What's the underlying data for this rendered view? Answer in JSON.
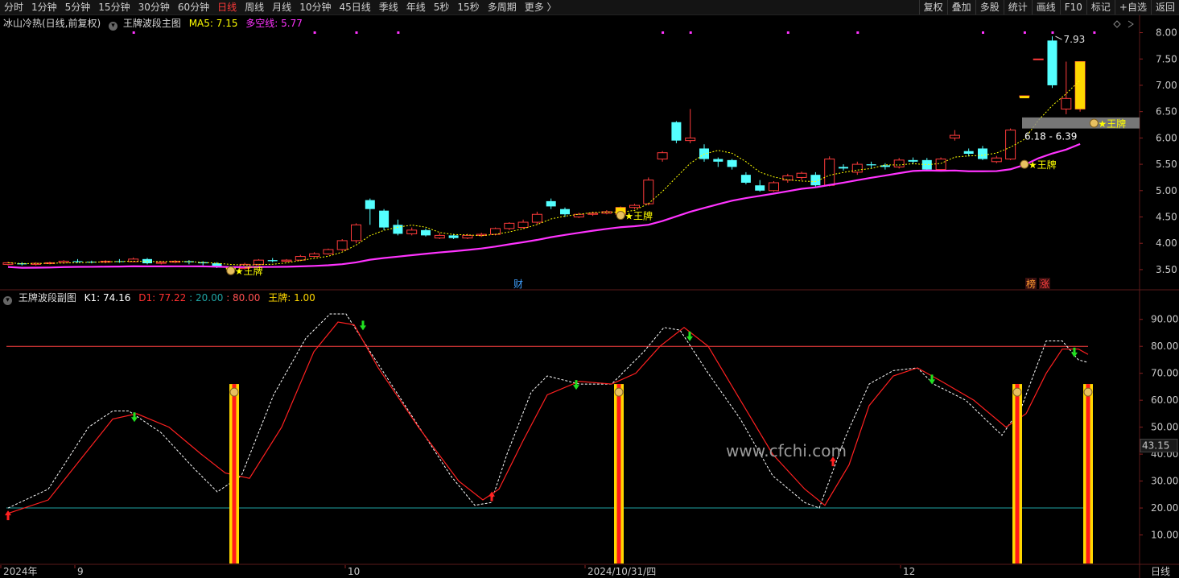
{
  "toolbar": {
    "periods": [
      "分时",
      "1分钟",
      "5分钟",
      "15分钟",
      "30分钟",
      "60分钟",
      "日线",
      "周线",
      "月线",
      "10分钟",
      "45日线",
      "季线",
      "年线",
      "5秒",
      "15秒",
      "多周期",
      "更多 〉"
    ],
    "active_period": "日线",
    "right_tools": [
      "复权",
      "叠加",
      "多股",
      "统计",
      "画线",
      "F10",
      "标记",
      "+自选",
      "返回"
    ]
  },
  "main_header": {
    "stock": "冰山冷热(日线,前复权)",
    "indicator": "王牌波段主图",
    "ma5_label": "MA5: 7.15",
    "dkx_label": "多空线: 5.77"
  },
  "sub_header": {
    "indicator": "王牌波段副图",
    "k1": "K1: 74.16",
    "d1": "D1: 77.22",
    "lv20": ": 20.00",
    "lv80": ": 80.00",
    "wangpai": "王牌: 1.00"
  },
  "annotations": {
    "high_price": "7.93",
    "range_label": "6.18 - 6.39",
    "wangpai_tag": "★王牌",
    "cai_tag": "财",
    "bang_tag": "榜",
    "zhang_tag": "涨",
    "watermark": "www.cfchi.com",
    "sub_current": "43.15"
  },
  "price_axis": [
    "8.00",
    "7.50",
    "7.00",
    "6.50",
    "6.00",
    "5.50",
    "5.00",
    "4.50",
    "4.00",
    "3.50"
  ],
  "osc_axis": [
    "90.00",
    "80.00",
    "70.00",
    "60.00",
    "50.00",
    "40.00",
    "30.00",
    "20.00",
    "10.00"
  ],
  "date_axis": {
    "labels": [
      "2024年",
      "9",
      "10",
      "2024/10/31/四",
      "12",
      "日线"
    ]
  },
  "colors": {
    "up": "#ff3b3b",
    "down": "#54ffff",
    "ma5": "#ffff00",
    "dkx": "#ff33ff",
    "k1": "#ffffff",
    "d1": "#ff2020",
    "level20": "#1fa3a3",
    "level80": "#ff4040",
    "wangpai_bar": "#ffd700"
  },
  "chart_data": {
    "type": "candlestick",
    "price_ylim": [
      3.3,
      8.1
    ],
    "osc_ylim": [
      0,
      95
    ],
    "candles": [
      [
        3.6,
        3.63,
        3.58,
        3.65
      ],
      [
        3.62,
        3.6,
        3.58,
        3.64
      ],
      [
        3.6,
        3.62,
        3.58,
        3.64
      ],
      [
        3.62,
        3.63,
        3.6,
        3.65
      ],
      [
        3.63,
        3.66,
        3.61,
        3.68
      ],
      [
        3.66,
        3.65,
        3.63,
        3.7
      ],
      [
        3.65,
        3.64,
        3.62,
        3.67
      ],
      [
        3.64,
        3.66,
        3.62,
        3.68
      ],
      [
        3.66,
        3.65,
        3.63,
        3.7
      ],
      [
        3.65,
        3.7,
        3.64,
        3.73
      ],
      [
        3.7,
        3.62,
        3.6,
        3.72
      ],
      [
        3.62,
        3.64,
        3.6,
        3.66
      ],
      [
        3.64,
        3.66,
        3.62,
        3.68
      ],
      [
        3.66,
        3.64,
        3.6,
        3.68
      ],
      [
        3.64,
        3.62,
        3.58,
        3.66
      ],
      [
        3.62,
        3.55,
        3.53,
        3.64
      ],
      [
        3.55,
        3.52,
        3.48,
        3.57
      ],
      [
        3.52,
        3.6,
        3.5,
        3.63
      ],
      [
        3.6,
        3.68,
        3.58,
        3.7
      ],
      [
        3.68,
        3.66,
        3.64,
        3.72
      ],
      [
        3.66,
        3.68,
        3.64,
        3.7
      ],
      [
        3.68,
        3.75,
        3.66,
        3.78
      ],
      [
        3.75,
        3.8,
        3.73,
        3.83
      ],
      [
        3.8,
        3.88,
        3.78,
        3.9
      ],
      [
        3.88,
        4.05,
        3.85,
        4.08
      ],
      [
        4.05,
        4.35,
        4.0,
        4.38
      ],
      [
        4.82,
        4.65,
        4.35,
        4.85
      ],
      [
        4.62,
        4.3,
        4.25,
        4.65
      ],
      [
        4.35,
        4.18,
        4.15,
        4.45
      ],
      [
        4.18,
        4.25,
        4.15,
        4.3
      ],
      [
        4.25,
        4.15,
        4.13,
        4.28
      ],
      [
        4.1,
        4.15,
        4.08,
        4.2
      ],
      [
        4.15,
        4.1,
        4.08,
        4.18
      ],
      [
        4.1,
        4.15,
        4.08,
        4.18
      ],
      [
        4.15,
        4.17,
        4.12,
        4.2
      ],
      [
        4.17,
        4.28,
        4.15,
        4.3
      ],
      [
        4.28,
        4.38,
        4.25,
        4.4
      ],
      [
        4.3,
        4.4,
        4.28,
        4.45
      ],
      [
        4.4,
        4.55,
        4.35,
        4.6
      ],
      [
        4.8,
        4.7,
        4.65,
        4.85
      ],
      [
        4.65,
        4.55,
        4.5,
        4.68
      ],
      [
        4.5,
        4.55,
        4.48,
        4.58
      ],
      [
        4.55,
        4.57,
        4.52,
        4.6
      ],
      [
        4.57,
        4.6,
        4.55,
        4.63
      ],
      [
        4.55,
        4.68,
        4.5,
        4.7
      ],
      [
        4.68,
        4.72,
        4.65,
        4.75
      ],
      [
        4.75,
        5.2,
        4.72,
        5.25
      ],
      [
        5.6,
        5.72,
        5.55,
        5.75
      ],
      [
        6.3,
        5.95,
        5.9,
        6.32
      ],
      [
        5.95,
        6.0,
        5.9,
        6.55
      ],
      [
        5.8,
        5.6,
        5.55,
        5.88
      ],
      [
        5.6,
        5.55,
        5.45,
        5.63
      ],
      [
        5.58,
        5.45,
        5.4,
        5.6
      ],
      [
        5.3,
        5.15,
        5.12,
        5.35
      ],
      [
        5.1,
        5.0,
        4.98,
        5.2
      ],
      [
        5.0,
        5.15,
        4.98,
        5.18
      ],
      [
        5.2,
        5.28,
        5.15,
        5.32
      ],
      [
        5.25,
        5.33,
        5.2,
        5.36
      ],
      [
        5.3,
        5.1,
        5.05,
        5.35
      ],
      [
        5.1,
        5.6,
        5.08,
        5.65
      ],
      [
        5.45,
        5.42,
        5.38,
        5.5
      ],
      [
        5.35,
        5.5,
        5.3,
        5.55
      ],
      [
        5.5,
        5.48,
        5.42,
        5.55
      ],
      [
        5.48,
        5.45,
        5.4,
        5.52
      ],
      [
        5.45,
        5.58,
        5.42,
        5.62
      ],
      [
        5.58,
        5.55,
        5.5,
        5.63
      ],
      [
        5.58,
        5.4,
        5.38,
        5.62
      ],
      [
        5.4,
        5.6,
        5.38,
        5.63
      ],
      [
        6.0,
        6.05,
        5.95,
        6.15
      ],
      [
        5.75,
        5.7,
        5.65,
        5.8
      ],
      [
        5.8,
        5.6,
        5.58,
        5.85
      ],
      [
        5.55,
        5.62,
        5.52,
        5.66
      ],
      [
        5.6,
        6.15,
        5.58,
        6.18
      ],
      [
        6.8,
        6.8,
        6.8,
        6.8
      ],
      [
        7.5,
        7.5,
        7.5,
        7.5
      ],
      [
        7.85,
        7.0,
        6.95,
        7.93
      ],
      [
        6.55,
        6.75,
        6.45,
        7.45
      ],
      [
        6.55,
        7.45,
        6.5,
        7.45
      ]
    ],
    "ma5_series": "yellow dotted, approx 3.62 → 7.15",
    "dkx_series": "magenta, approx 3.65 → 5.77",
    "k1_last": 74.16,
    "d1_last": 77.22,
    "levels": [
      20,
      80
    ],
    "wangpai_signal_last": 1.0
  }
}
